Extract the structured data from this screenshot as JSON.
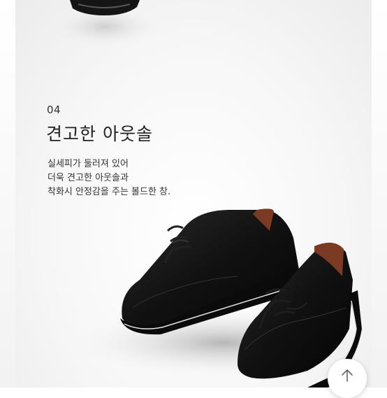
{
  "section": {
    "number": "04",
    "title": "견고한 아웃솔",
    "description": [
      "실세피가 둘러져 있어",
      "더욱 견고한 아웃솔과",
      "착화시 안정감을 주는 볼드한 창."
    ]
  },
  "icons": {
    "scroll_top": "arrow-up-icon",
    "top_image": "shoe-photo-partial",
    "main_image": "shoe-pair-photo"
  },
  "colors": {
    "shoe": "#141414",
    "lining": "#7a3a24",
    "background": "#f4f4f4"
  }
}
